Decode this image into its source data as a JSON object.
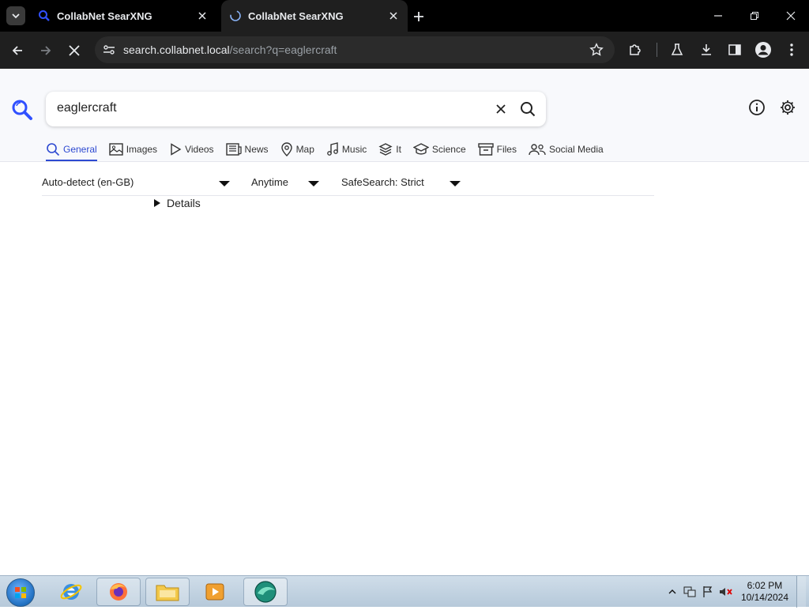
{
  "browser": {
    "tabs": [
      {
        "title": "CollabNet SearXNG",
        "active": false
      },
      {
        "title": "CollabNet SearXNG",
        "active": true
      }
    ],
    "address": {
      "host": "search.collabnet.local",
      "path": "/search?q=eaglercraft"
    }
  },
  "search": {
    "query": "eaglercraft"
  },
  "categories": [
    {
      "label": "General",
      "icon": "search-icon",
      "active": true
    },
    {
      "label": "Images",
      "icon": "image-icon"
    },
    {
      "label": "Videos",
      "icon": "play-icon"
    },
    {
      "label": "News",
      "icon": "newspaper-icon"
    },
    {
      "label": "Map",
      "icon": "map-pin-icon"
    },
    {
      "label": "Music",
      "icon": "music-note-icon"
    },
    {
      "label": "It",
      "icon": "layers-icon"
    },
    {
      "label": "Science",
      "icon": "school-icon"
    },
    {
      "label": "Files",
      "icon": "archive-icon"
    },
    {
      "label": "Social Media",
      "icon": "people-icon"
    }
  ],
  "filters": {
    "language": "Auto-detect (en-GB)",
    "time_range": "Anytime",
    "safesearch": "SafeSearch: Strict"
  },
  "details_label": "Details",
  "taskbar": {
    "time": "6:02 PM",
    "date": "10/14/2024"
  },
  "colors": {
    "accent": "#2d49d1",
    "chrome_bg": "#1f1f1f"
  }
}
